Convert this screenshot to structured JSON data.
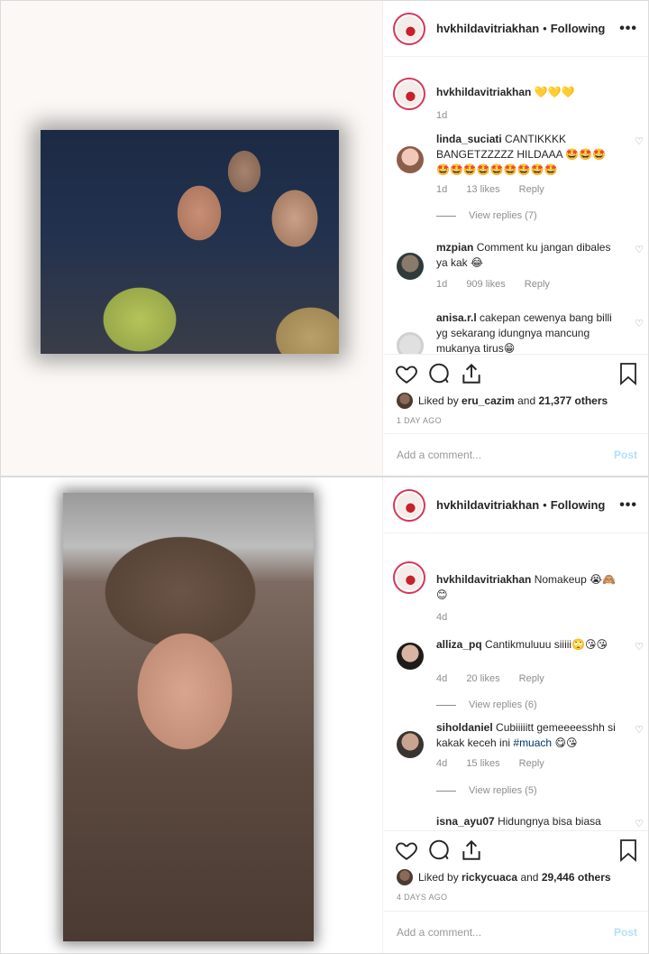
{
  "posts": [
    {
      "username": "hvkhildavitriakhan",
      "dot": "•",
      "follow_label": "Following",
      "more": "•••",
      "caption": {
        "user": "hvkhildavitriakhan",
        "text": "💛💛💛",
        "time": "1d"
      },
      "comments": [
        {
          "user": "linda_suciati",
          "text": "CANTIKKKK BANGETZZZZZ HILDAAA 🤩🤩🤩🤩🤩🤩🤩🤩🤩🤩🤩🤩",
          "time": "1d",
          "likes": "13 likes",
          "reply": "Reply",
          "view_replies": "View replies (7)"
        },
        {
          "user": "mzpian",
          "text": "Comment ku jangan dibales ya kak 😂",
          "time": "1d",
          "likes": "909 likes",
          "reply": "Reply"
        },
        {
          "user": "anisa.r.l",
          "text": "cakepan cewenya bang billi yg sekarang idungnya mancung mukanya tirus😁"
        }
      ],
      "liked_by": "eru_cazim",
      "liked_prefix": "Liked by",
      "liked_and": "and",
      "liked_others": "21,377 others",
      "timestamp": "1 DAY AGO",
      "add_comment_placeholder": "Add a comment...",
      "post_button": "Post"
    },
    {
      "username": "hvkhildavitriakhan",
      "dot": "•",
      "follow_label": "Following",
      "more": "•••",
      "caption": {
        "user": "hvkhildavitriakhan",
        "text": "Nomakeup 😭🙈😊",
        "time": "4d"
      },
      "comments": [
        {
          "user": "alliza_pq",
          "text": "Cantikmuluuu siiiii🙄😘😘",
          "time": "4d",
          "likes": "20 likes",
          "reply": "Reply",
          "view_replies": "View replies (6)"
        },
        {
          "user": "siholdaniel",
          "text": "Cubiiiiitt gemeeeesshh si kakak keceh ini",
          "hashtag": "#muach",
          "emoji": "😋😘",
          "time": "4d",
          "likes": "15 likes",
          "reply": "Reply",
          "view_replies": "View replies (5)"
        },
        {
          "user": "isna_ayu07",
          "text": "Hidungnya bisa biasa"
        }
      ],
      "liked_by": "rickycuaca",
      "liked_prefix": "Liked by",
      "liked_and": "and",
      "liked_others": "29,446 others",
      "timestamp": "4 DAYS AGO",
      "add_comment_placeholder": "Add a comment...",
      "post_button": "Post"
    }
  ],
  "icons": {
    "heart": "heart-icon",
    "comment": "comment-icon",
    "share": "share-icon",
    "bookmark": "bookmark-icon",
    "more": "more-options-icon"
  },
  "colors": {
    "story_ring": "#d9345a",
    "text": "#262626",
    "muted": "#8e8e8e",
    "hashtag": "#003569",
    "post_disabled": "#b2dffc"
  }
}
